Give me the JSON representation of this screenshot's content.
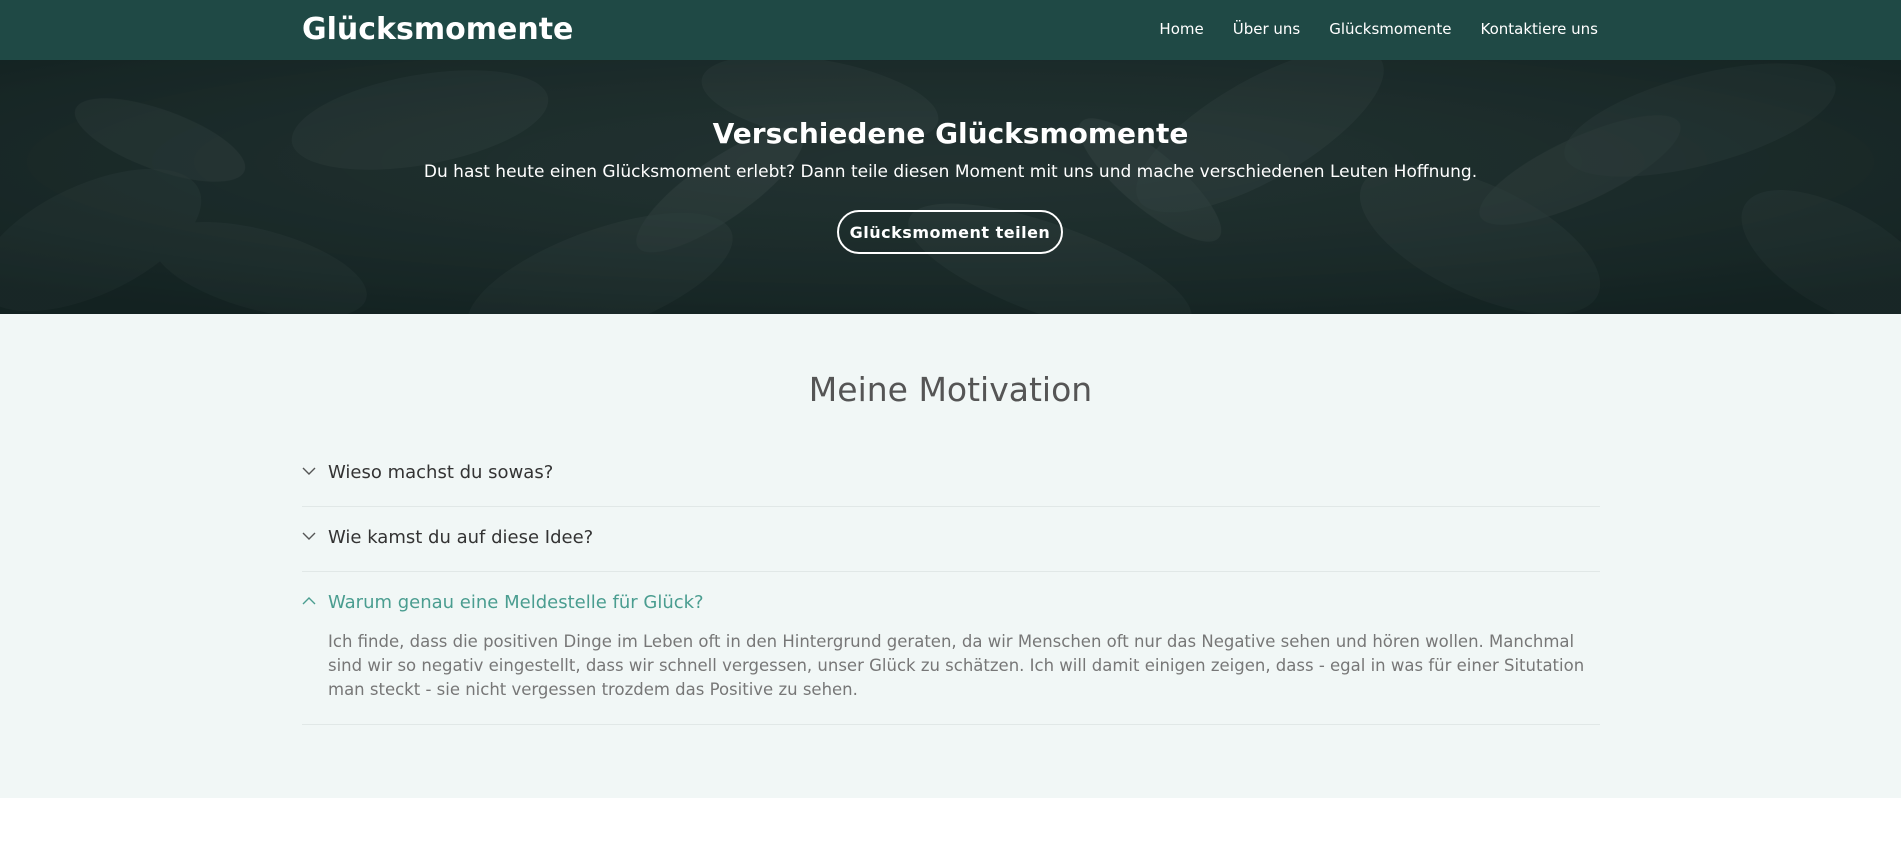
{
  "navbar": {
    "brand": "Glücksmomente",
    "links": [
      "Home",
      "Über uns",
      "Glücksmomente",
      "Kontaktiere uns"
    ]
  },
  "hero": {
    "title": "Verschiedene Glücksmomente",
    "subtitle": "Du hast heute einen Glücksmoment erlebt? Dann teile diesen Moment mit uns und mache verschiedenen Leuten Hoffnung.",
    "button_label": "Glücksmoment teilen"
  },
  "motivation": {
    "title": "Meine Motivation",
    "items": [
      {
        "question": "Wieso machst du sowas?",
        "open": false
      },
      {
        "question": "Wie kamst du auf diese Idee?",
        "open": false
      },
      {
        "question": "Warum genau eine Meldestelle für Glück?",
        "open": true,
        "answer": "Ich finde, dass die positiven Dinge im Leben oft in den Hintergrund geraten, da wir Menschen oft nur das Negative sehen und hören wollen. Manchmal sind wir so negativ eingestellt, dass wir schnell vergessen, unser Glück zu schätzen. Ich will damit einigen zeigen, dass - egal in was für einer Situtation man steckt - sie nicht vergessen trozdem das Positive zu sehen."
      }
    ]
  },
  "colors": {
    "navbar": "#1f4945",
    "accent": "#4a9d90",
    "section_bg": "#f1f7f6"
  },
  "icons": {
    "collapsed": "chevron-down-icon",
    "expanded": "chevron-up-icon"
  }
}
